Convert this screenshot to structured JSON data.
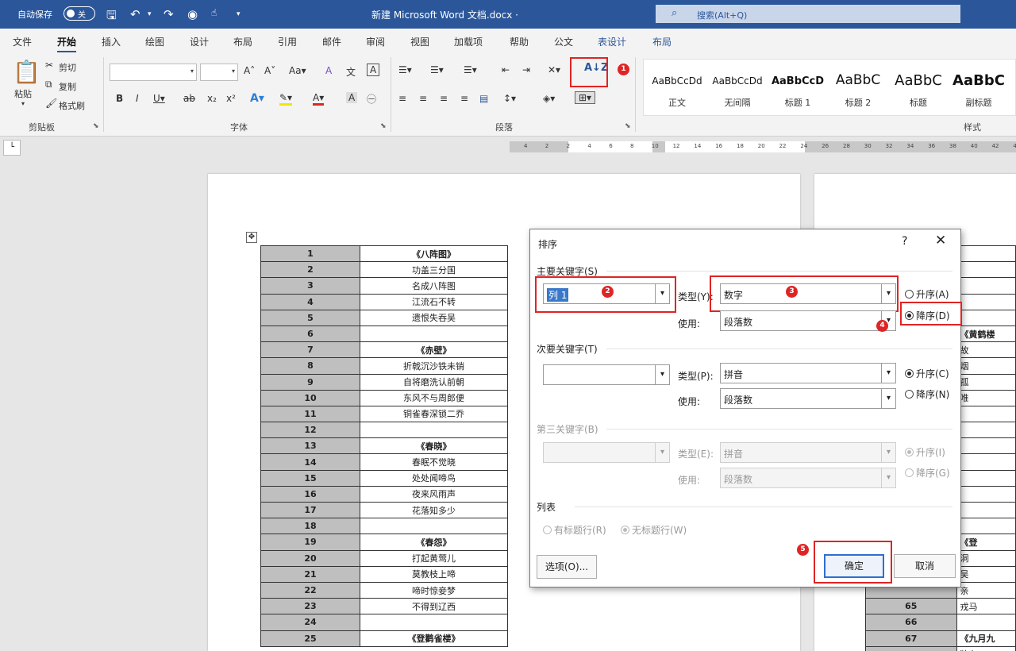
{
  "titlebar": {
    "autosave_label": "自动保存",
    "autosave_state": "关",
    "doc_title": "新建 Microsoft Word 文档.docx ·",
    "search_placeholder": "搜索(Alt+Q)"
  },
  "tabs": [
    "文件",
    "开始",
    "插入",
    "绘图",
    "设计",
    "布局",
    "引用",
    "邮件",
    "审阅",
    "视图",
    "加载项",
    "帮助",
    "公文",
    "表设计",
    "布局"
  ],
  "active_tab": "开始",
  "ribbon": {
    "clipboard": {
      "paste": "粘贴",
      "cut": "剪切",
      "copy": "复制",
      "format_painter": "格式刷",
      "group_label": "剪贴板"
    },
    "font": {
      "group_label": "字体"
    },
    "paragraph": {
      "group_label": "段落"
    },
    "styles": {
      "group_label": "样式",
      "items": [
        {
          "preview": "AaBbCcDd",
          "name": "正文"
        },
        {
          "preview": "AaBbCcDd",
          "name": "无间隔"
        },
        {
          "preview": "AaBbCcD",
          "name": "标题 1"
        },
        {
          "preview": "AaBbC",
          "name": "标题 2"
        },
        {
          "preview": "AaBbC",
          "name": "标题"
        },
        {
          "preview": "AaBbC",
          "name": "副标题"
        }
      ]
    }
  },
  "ruler_ticks": [
    "4",
    "2",
    "2",
    "4",
    "6",
    "8",
    "10",
    "12",
    "14",
    "16",
    "18",
    "20",
    "22",
    "24",
    "26",
    "28",
    "30",
    "32",
    "34",
    "36",
    "38",
    "40",
    "42",
    "44"
  ],
  "table_left": [
    {
      "n": "1",
      "t": "《八阵图》",
      "b": true
    },
    {
      "n": "2",
      "t": "功盖三分国"
    },
    {
      "n": "3",
      "t": "名成八阵图"
    },
    {
      "n": "4",
      "t": "江流石不转"
    },
    {
      "n": "5",
      "t": "遗恨失吞吴"
    },
    {
      "n": "6",
      "t": ""
    },
    {
      "n": "7",
      "t": "《赤壁》",
      "b": true
    },
    {
      "n": "8",
      "t": "折戟沉沙铁未销"
    },
    {
      "n": "9",
      "t": "自将磨洗认前朝"
    },
    {
      "n": "10",
      "t": "东风不与周郎便"
    },
    {
      "n": "11",
      "t": "铜雀春深锁二乔"
    },
    {
      "n": "12",
      "t": ""
    },
    {
      "n": "13",
      "t": "《春晓》",
      "b": true
    },
    {
      "n": "14",
      "t": "春眠不觉晓"
    },
    {
      "n": "15",
      "t": "处处闻啼鸟"
    },
    {
      "n": "16",
      "t": "夜来风雨声"
    },
    {
      "n": "17",
      "t": "花落知多少"
    },
    {
      "n": "18",
      "t": ""
    },
    {
      "n": "19",
      "t": "《春怨》",
      "b": true
    },
    {
      "n": "20",
      "t": "打起黄莺儿"
    },
    {
      "n": "21",
      "t": "莫教枝上啼"
    },
    {
      "n": "22",
      "t": "啼时惊妾梦"
    },
    {
      "n": "23",
      "t": "不得到辽西"
    },
    {
      "n": "24",
      "t": ""
    },
    {
      "n": "25",
      "t": "《登鹳雀楼》",
      "b": true
    }
  ],
  "table_right": [
    {
      "n": "",
      "t": ""
    },
    {
      "n": "",
      "t": ""
    },
    {
      "n": "",
      "t": ""
    },
    {
      "n": "",
      "t": ""
    },
    {
      "n": "",
      "t": ""
    },
    {
      "n": "",
      "t": "《黄鹤楼",
      "b": true
    },
    {
      "n": "",
      "t": "故"
    },
    {
      "n": "",
      "t": "烟"
    },
    {
      "n": "",
      "t": "孤"
    },
    {
      "n": "",
      "t": "唯"
    },
    {
      "n": "",
      "t": ""
    },
    {
      "n": "",
      "t": ""
    },
    {
      "n": "",
      "t": ""
    },
    {
      "n": "",
      "t": ""
    },
    {
      "n": "",
      "t": ""
    },
    {
      "n": "",
      "t": ""
    },
    {
      "n": "",
      "t": ""
    },
    {
      "n": "",
      "t": ""
    },
    {
      "n": "",
      "t": "《登",
      "b": true
    },
    {
      "n": "",
      "t": "洞"
    },
    {
      "n": "",
      "t": "吴"
    },
    {
      "n": "",
      "t": "亲"
    },
    {
      "n": "65",
      "t": "戎马"
    },
    {
      "n": "66",
      "t": ""
    },
    {
      "n": "67",
      "t": "《九月九",
      "b": true
    },
    {
      "n": "68",
      "t": "独在"
    }
  ],
  "dialog": {
    "title": "排序",
    "help": "?",
    "close": "✕",
    "primary": {
      "section": "主要关键字(S)",
      "key_value": "列 1",
      "type_label": "类型(Y):",
      "type_value": "数字",
      "using_label": "使用:",
      "using_value": "段落数",
      "ascending": "升序(A)",
      "descending": "降序(D)",
      "selected": "descending"
    },
    "secondary": {
      "section": "次要关键字(T)",
      "key_value": "",
      "type_label": "类型(P):",
      "type_value": "拼音",
      "using_label": "使用:",
      "using_value": "段落数",
      "ascending": "升序(C)",
      "descending": "降序(N)",
      "selected": "ascending"
    },
    "tertiary": {
      "section": "第三关键字(B)",
      "key_value": "",
      "type_label": "类型(E):",
      "type_value": "拼音",
      "using_label": "使用:",
      "using_value": "段落数",
      "ascending": "升序(I)",
      "descending": "降序(G)",
      "selected": "ascending"
    },
    "list": {
      "section": "列表",
      "has_header": "有标题行(R)",
      "no_header": "无标题行(W)",
      "selected": "no_header"
    },
    "options_button": "选项(O)...",
    "ok_button": "确定",
    "cancel_button": "取消"
  },
  "annotations": {
    "badges": [
      "1",
      "2",
      "3",
      "4",
      "5"
    ],
    "color": "#e02424"
  },
  "colors": {
    "title_bar": "#2b579a",
    "accent": "#2b579a",
    "highlight": "#e02424",
    "number_cell": "#bfbfbf"
  }
}
